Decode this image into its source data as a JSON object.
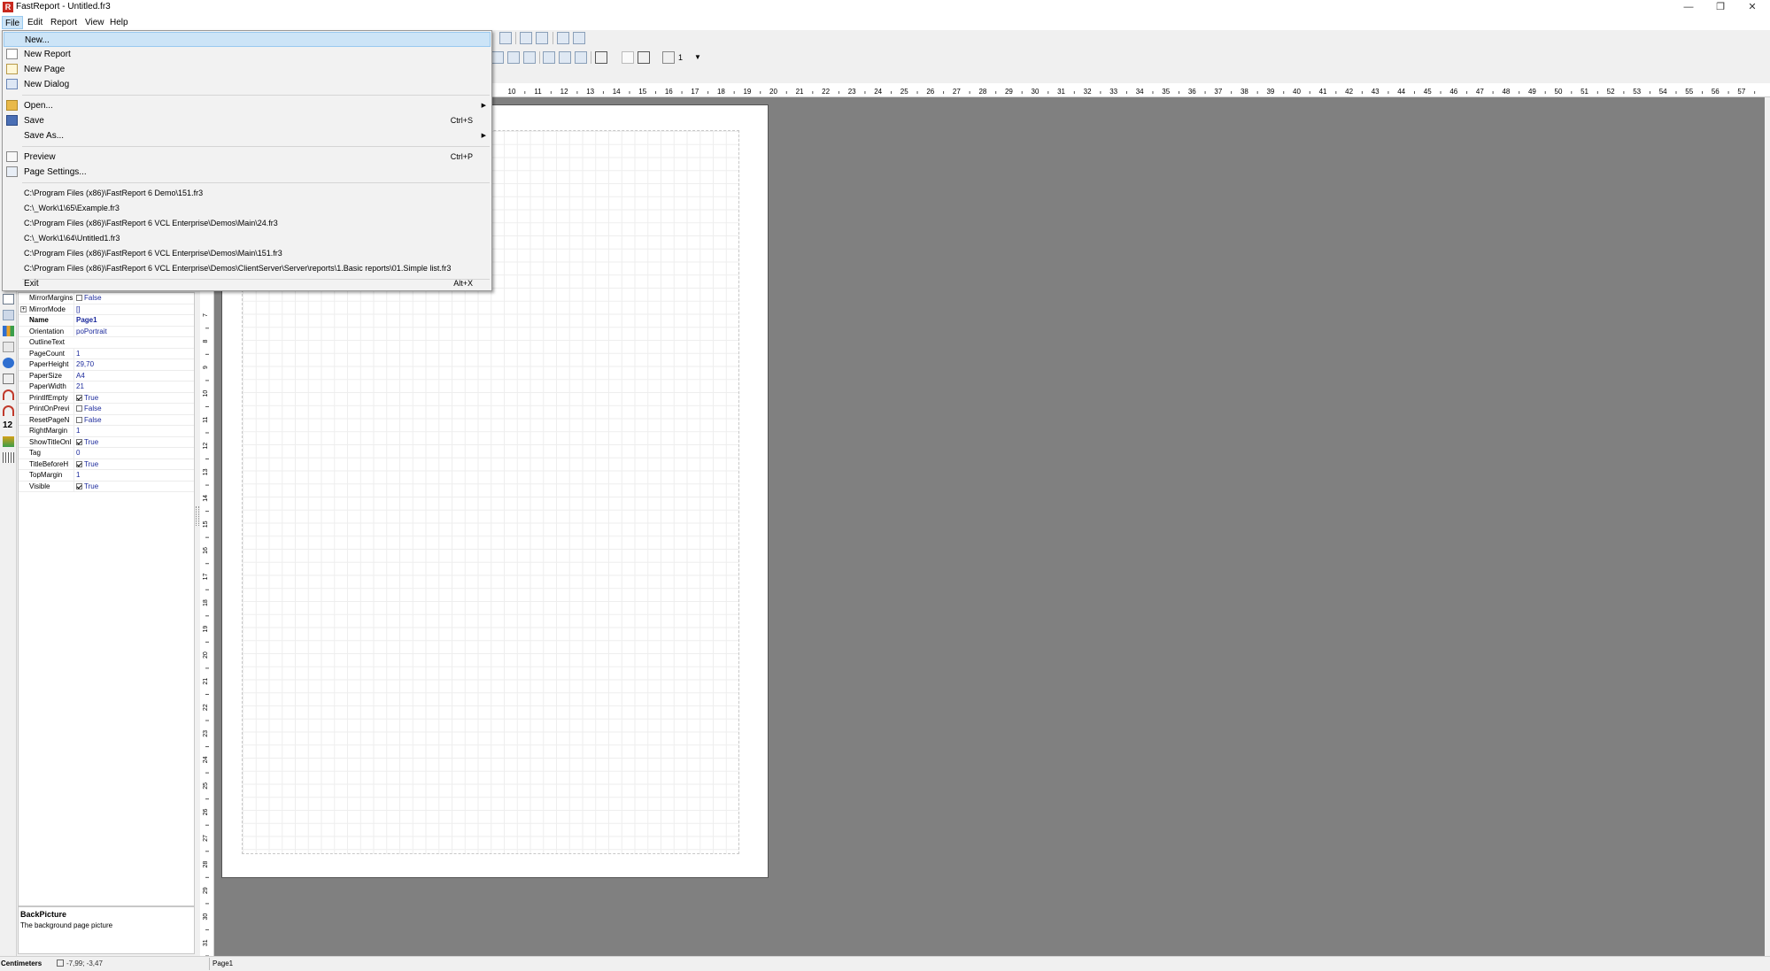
{
  "window": {
    "title": "FastReport - Untitled.fr3",
    "app_icon_letter": "R",
    "minimize": "—",
    "restore": "❐",
    "close": "✕"
  },
  "menubar": {
    "items": [
      "File",
      "Edit",
      "Report",
      "View",
      "Help"
    ]
  },
  "file_menu": {
    "new": "New...",
    "new_report": "New Report",
    "new_page": "New Page",
    "new_dialog": "New Dialog",
    "open": "Open...",
    "save": "Save",
    "save_shortcut": "Ctrl+S",
    "save_as": "Save As...",
    "preview": "Preview",
    "preview_shortcut": "Ctrl+P",
    "page_settings": "Page Settings...",
    "recent_files": [
      "C:\\Program Files (x86)\\FastReport 6 Demo\\151.fr3",
      "C:\\_Work\\1\\65\\Example.fr3",
      "C:\\Program Files (x86)\\FastReport 6 VCL Enterprise\\Demos\\Main\\24.fr3",
      "C:\\_Work\\1\\64\\Untitled1.fr3",
      "C:\\Program Files (x86)\\FastReport 6 VCL Enterprise\\Demos\\Main\\151.fr3",
      "C:\\Program Files (x86)\\FastReport 6 VCL Enterprise\\Demos\\ClientServer\\Server\\reports\\1.Basic reports\\01.Simple list.fr3"
    ],
    "exit": "Exit",
    "exit_shortcut": "Alt+X"
  },
  "toolbar": {
    "line_width_value": "1"
  },
  "inspector": {
    "properties": [
      {
        "name": "MirrorMargins",
        "value": "False",
        "checkbox": "off"
      },
      {
        "name": "MirrorMode",
        "value": "[]",
        "expander": true
      },
      {
        "name": "Name",
        "value": "Page1",
        "bold": true
      },
      {
        "name": "Orientation",
        "value": "poPortrait"
      },
      {
        "name": "OutlineText",
        "value": ""
      },
      {
        "name": "PageCount",
        "value": "1"
      },
      {
        "name": "PaperHeight",
        "value": "29,70"
      },
      {
        "name": "PaperSize",
        "value": "A4"
      },
      {
        "name": "PaperWidth",
        "value": "21"
      },
      {
        "name": "PrintIfEmpty",
        "value": "True",
        "checkbox": "on"
      },
      {
        "name": "PrintOnPrevi",
        "value": "False",
        "checkbox": "off"
      },
      {
        "name": "ResetPageN",
        "value": "False",
        "checkbox": "off"
      },
      {
        "name": "RightMargin",
        "value": "1"
      },
      {
        "name": "ShowTitleOnl",
        "value": "True",
        "checkbox": "on"
      },
      {
        "name": "Tag",
        "value": "0"
      },
      {
        "name": "TitleBeforeH",
        "value": "True",
        "checkbox": "on"
      },
      {
        "name": "TopMargin",
        "value": "1"
      },
      {
        "name": "Visible",
        "value": "True",
        "checkbox": "on"
      }
    ]
  },
  "description": {
    "title": "BackPicture",
    "text": "The background page picture"
  },
  "status": {
    "units": "Centimeters",
    "coords": "-7,99; -3,47",
    "page": "Page1"
  },
  "rulers": {
    "h_labels": [
      "10",
      "11",
      "12",
      "13",
      "14",
      "15",
      "16",
      "17",
      "18",
      "19",
      "20",
      "21",
      "22",
      "23",
      "24",
      "25",
      "26",
      "27",
      "28",
      "29",
      "30",
      "31",
      "32",
      "33",
      "34",
      "35",
      "36",
      "37",
      "38",
      "39",
      "40",
      "41",
      "42",
      "43",
      "44",
      "45",
      "46",
      "47",
      "48",
      "49",
      "50",
      "51",
      "52",
      "53",
      "54",
      "55",
      "56",
      "57"
    ],
    "v_labels": [
      "7",
      "8",
      "9",
      "10",
      "11",
      "12",
      "13",
      "14",
      "15",
      "16",
      "17",
      "18",
      "19",
      "20",
      "21",
      "22",
      "23",
      "24",
      "25",
      "26",
      "27",
      "28",
      "29",
      "30",
      "31"
    ]
  },
  "colors": {
    "workspace": "#808080",
    "menu_highlight": "#cce4f7",
    "property_value": "#1c2a9c"
  }
}
